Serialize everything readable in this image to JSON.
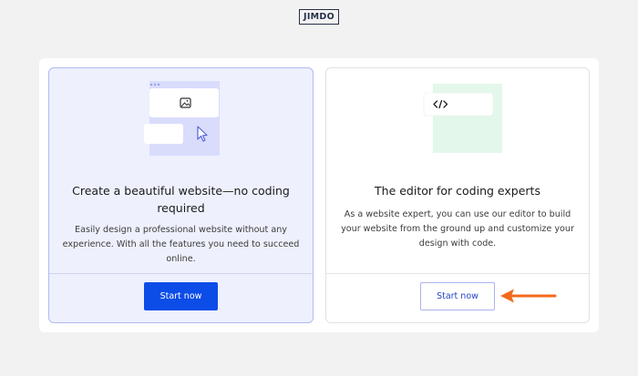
{
  "brand": {
    "logo_text": "JIMDO"
  },
  "cards": [
    {
      "title": "Create a beautiful website—no coding required",
      "description": "Easily design a professional website without any experience. With all the features you need to succeed online.",
      "button_label": "Start now",
      "illustration_icons": [
        "image-icon",
        "cursor-icon"
      ]
    },
    {
      "title": "The editor for coding experts",
      "description": "As a website expert, you can use our editor to build your website from the ground up and customize your design with code.",
      "button_label": "Start now",
      "illustration_icons": [
        "code-icon"
      ]
    }
  ],
  "annotation": {
    "arrow_color": "#f26a1b",
    "arrow_icon": "arrow-left-icon"
  },
  "colors": {
    "primary_button": "#0c4de8",
    "selected_card_background": "#eef0fd",
    "selected_card_border": "#b3baf2",
    "code_illustration_background": "#e3f8ea"
  }
}
